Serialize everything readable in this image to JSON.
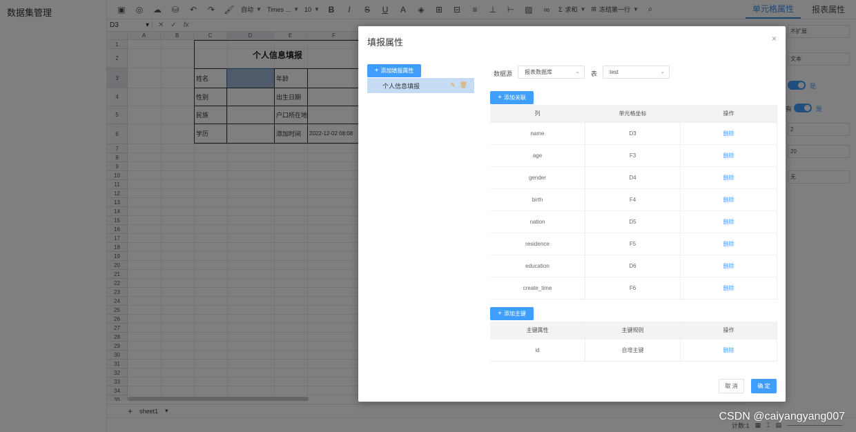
{
  "app": {
    "sidebar_title": "数据集管理"
  },
  "toolbar": {
    "align_label": "自动",
    "font_family": "Times ...",
    "font_size": "10",
    "sum_label": "求和",
    "freeze_label": "冻结第一行"
  },
  "right_tabs": [
    {
      "label": "单元格属性",
      "active": true
    },
    {
      "label": "报表属性",
      "active": false
    }
  ],
  "formula_bar": {
    "cell_ref": "D3",
    "fx": "fx",
    "cancel": "✕",
    "confirm": "✓"
  },
  "sheet": {
    "columns": [
      "A",
      "B",
      "C",
      "D",
      "E",
      "F"
    ],
    "selected_column": "D",
    "selected_row": 3,
    "rows": [
      "1",
      "2",
      "3",
      "4",
      "5",
      "6",
      "7",
      "8",
      "9",
      "10",
      "11",
      "12",
      "13",
      "14",
      "15",
      "16",
      "17",
      "18",
      "19",
      "20",
      "21",
      "22",
      "23",
      "24",
      "25",
      "26",
      "27",
      "28",
      "29",
      "30",
      "31",
      "32",
      "33",
      "34",
      "35"
    ],
    "form_title": "个人信息填报",
    "labels": {
      "name": "姓名",
      "age": "年龄",
      "gender": "性别",
      "birth": "出生日期",
      "nation": "民族",
      "residence": "户口所在地",
      "education": "学历",
      "create_time": "添加时间",
      "create_time_value": "2022-12-02 08:08"
    }
  },
  "sheet_tabs": {
    "add": "+",
    "current": "sheet1",
    "caret": "▾"
  },
  "status_bar": {
    "count_label": "计数:1"
  },
  "right_panel": {
    "expand_value": "不扩展",
    "type_value": "文本",
    "toggle1_label": "是",
    "toggle2_prefix": "有",
    "toggle2_label": "是",
    "num1": "2",
    "num2": "20",
    "none_value": "无"
  },
  "modal": {
    "title": "填报属性",
    "close": "×",
    "add_property_button": "添加填报属性",
    "tree_item": "个人信息填报",
    "datasource_label": "数据源",
    "datasource_value": "报表数据库",
    "table_label": "表",
    "table_value": "test",
    "add_relation_button": "添加关联",
    "relation_headers": [
      "列",
      "单元格坐标",
      "操作"
    ],
    "relation_rows": [
      {
        "column": "name",
        "cell": "D3",
        "action": "删除"
      },
      {
        "column": "age",
        "cell": "F3",
        "action": "删除"
      },
      {
        "column": "gender",
        "cell": "D4",
        "action": "删除"
      },
      {
        "column": "birth",
        "cell": "F4",
        "action": "删除"
      },
      {
        "column": "nation",
        "cell": "D5",
        "action": "删除"
      },
      {
        "column": "residence",
        "cell": "F5",
        "action": "删除"
      },
      {
        "column": "education",
        "cell": "D6",
        "action": "删除"
      },
      {
        "column": "create_time",
        "cell": "F6",
        "action": "删除"
      }
    ],
    "add_key_button": "添加主键",
    "key_headers": [
      "主键属性",
      "主键规则",
      "操作"
    ],
    "key_rows": [
      {
        "attr": "id",
        "rule": "自增主键",
        "action": "删除"
      }
    ],
    "cancel_button": "取 消",
    "ok_button": "确 定"
  },
  "watermark": "CSDN @caiyangyang007",
  "colors": {
    "primary": "#409eff",
    "selected_cell": "#9fb7d2",
    "overlay": "rgba(0,0,0,0.5)"
  }
}
